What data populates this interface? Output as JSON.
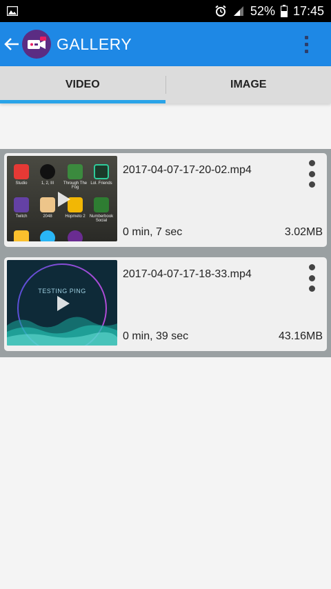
{
  "status_bar": {
    "battery": "52%",
    "time": "17:45"
  },
  "app_bar": {
    "title": "GALLERY"
  },
  "tabs": [
    {
      "label": "VIDEO",
      "active": true
    },
    {
      "label": "IMAGE",
      "active": false
    }
  ],
  "videos": [
    {
      "file_name": "2017-04-07-17-20-02.mp4",
      "duration": "0 min, 7 sec",
      "size": "3.02MB"
    },
    {
      "file_name": "2017-04-07-17-18-33.mp4",
      "duration": "0 min, 39 sec",
      "size": "43.16MB"
    }
  ],
  "thumb_1": {
    "apps": [
      {
        "label": "Studio"
      },
      {
        "label": "1, 2, III"
      },
      {
        "label": "Through The Fog"
      },
      {
        "label": "Lol. Friends"
      },
      {
        "label": "Twitch"
      },
      {
        "label": "2048"
      },
      {
        "label": "Hopmeto 2"
      },
      {
        "label": "Numberbook Social"
      }
    ]
  },
  "thumb_2": {
    "overlay_text": "TESTING PING"
  },
  "colors": {
    "app_bar": "#1e88e5",
    "tab_indicator": "#29a3e8",
    "list_background": "#9aa0a2"
  }
}
